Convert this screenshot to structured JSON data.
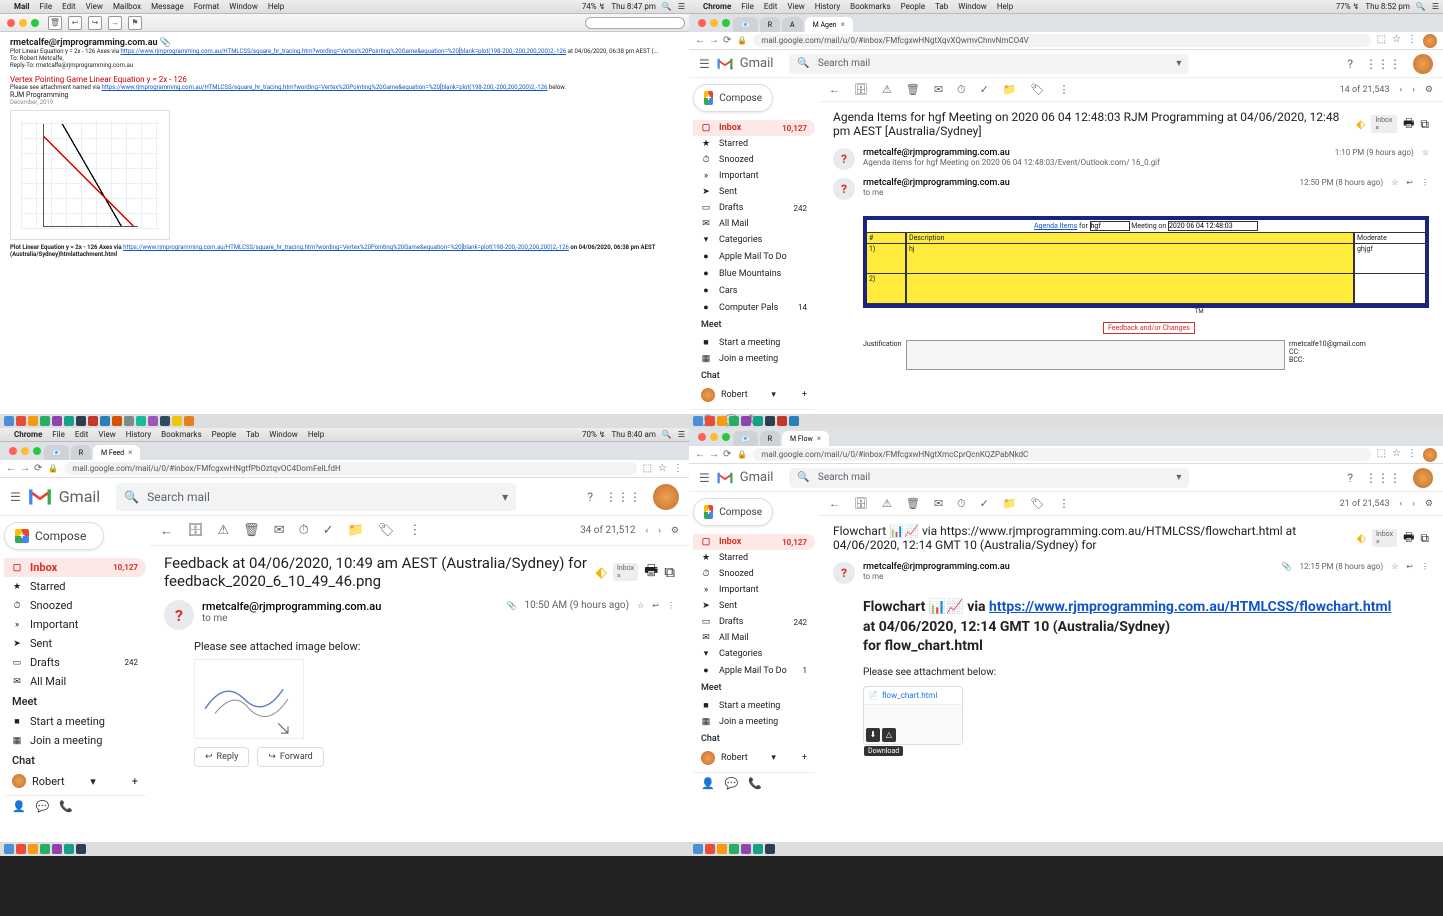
{
  "menubar_q1": {
    "app": "Mail",
    "menus": [
      "File",
      "Edit",
      "View",
      "Mailbox",
      "Message",
      "Format",
      "Window",
      "Help"
    ],
    "right": [
      "✈",
      "M",
      "⎆",
      "⚼",
      "⇪",
      "74% ↯",
      "Thu 8:47 pm",
      "🔍",
      "☰"
    ]
  },
  "menubar_q2": {
    "app": "Chrome",
    "menus": [
      "File",
      "Edit",
      "View",
      "History",
      "Bookmarks",
      "People",
      "Tab",
      "Window",
      "Help"
    ],
    "right": [
      "✈",
      "M",
      "⎆",
      "⚼",
      "⇪",
      "77% ↯",
      "Thu 8:52 pm",
      "🔍",
      "☰"
    ]
  },
  "menubar_q3": {
    "app": "Chrome",
    "menus": [
      "File",
      "Edit",
      "View",
      "History",
      "Bookmarks",
      "People",
      "Tab",
      "Window",
      "Help"
    ],
    "right": [
      "✈",
      "M",
      "⎆",
      "⚼",
      "⇪",
      "70% ↯",
      "Thu 8:40 am",
      "🔍",
      "☰"
    ]
  },
  "q1": {
    "from": "rmetcalfe@rjmprogramming.com.au",
    "line1_a": "Plot Linear Equation y = 2x - 126 Axes via ",
    "line1_url": "https://www.rjmprogramming.com.au/HTMLCSS/square_hr_tracing.htm?wording=Vertex%20Pointing%20Game&equation=%20[blank=plot(198-200,-200,200,200)2,-126",
    "line1_b": " at 04/06/2020, 06:38 pm AEST (...",
    "to": "To: Robert Metcalfe,",
    "replyto": "Reply-To: rmetcalfe@rjmprogramming.com.au",
    "heading": "Vertex Pointing Game Linear Equation y = 2x - 126",
    "subline_a": "Please see attachment named via ",
    "subline_url": "https://www.rjmprogramming.com.au/HTMLCSS/square_hr_tracing.htm?wording=Vertex%20Pointing%20Game&equation=%20[blank=plot(198-200,-200,200,200)2,-126",
    "subline_b": " below.",
    "sig1": "RJM Programming",
    "sig2": "December, 2019",
    "foot_a": "Plot Linear Equation y = 2x - 126 Axes via ",
    "foot_url": "https://www.rjmprogramming.com.au/HTMLCSS/square_hr_tracing.htm?wording=Vertex%20Pointing%20Game&equation=%20[blank=plot(198-200,-200,200,200)2,-126",
    "foot_b": " on 04/06/2020, 06:38 pm AEST (Australia/Sydney)htmlattachment.html"
  },
  "q2": {
    "url": "mail.google.com/mail/u/0/#inbox/FMfcgxwHNgtXqvXQwmvChnvNmCO4V",
    "search_placeholder": "Search mail",
    "counter": "14 of 21,543",
    "compose": "Compose",
    "sidebar": [
      {
        "ic": "▢",
        "label": "Inbox",
        "count": "10,127",
        "active": true
      },
      {
        "ic": "★",
        "label": "Starred"
      },
      {
        "ic": "⏱",
        "label": "Snoozed"
      },
      {
        "ic": "»",
        "label": "Important"
      },
      {
        "ic": "➤",
        "label": "Sent"
      },
      {
        "ic": "▭",
        "label": "Drafts",
        "count": "242"
      },
      {
        "ic": "✉",
        "label": "All Mail"
      },
      {
        "ic": "▾",
        "label": "Categories"
      },
      {
        "ic": "●",
        "label": "Apple Mail To Do"
      },
      {
        "ic": "●",
        "label": "Blue Mountains"
      },
      {
        "ic": "●",
        "label": "Cars"
      },
      {
        "ic": "●",
        "label": "Computer Pals",
        "count": "14"
      }
    ],
    "meet": "Meet",
    "meet_items": [
      "Start a meeting",
      "Join a meeting"
    ],
    "chat": "Chat",
    "chat_user": "Robert",
    "subject": "Agenda Items for hgf Meeting on 2020  06  04 12:48:03    RJM Programming at 04/06/2020, 12:48 pm AEST [Australia/Sydney]",
    "inbox_label": "Inbox ×",
    "sender": "rmetcalfe@rjmprogramming.com.au",
    "attach_name": "Agenda items for hgf Meeting on 2020 06 04 12:48:03/Event/Outlook.com/ 16_0.gif",
    "time1": "1:10 PM (9 hours ago)",
    "time2": "12:50 PM (8 hours ago)",
    "tome": "to me",
    "agenda_title_a": "Agenda Items",
    "agenda_title_b": " for ",
    "agenda_input": "hgf",
    "agenda_title_c": " Meeting on ",
    "agenda_date": "2020 06 04 12:48:03",
    "agenda_hdr": [
      "#",
      "Description",
      "Moderate"
    ],
    "agenda_rows": [
      {
        "n": "1)",
        "d": "hj",
        "m": "ghjgf"
      },
      {
        "n": "2)",
        "d": "",
        "m": ""
      }
    ],
    "feedback_btn": "Feedback and/or Changes",
    "tm": "TM",
    "justif_label": "Justification",
    "recipient": "rmetcalfe10@gmail.com",
    "cc": "CC:",
    "bcc": "BCC:"
  },
  "q3": {
    "url": "mail.google.com/mail/u/0/#inbox/FMfcgxwHNgtfPbOztqvOC4DomFelLfdH",
    "search_placeholder": "Search mail",
    "counter": "34 of 21,512",
    "compose": "Compose",
    "sidebar": [
      {
        "ic": "▢",
        "label": "Inbox",
        "count": "10,127",
        "active": true
      },
      {
        "ic": "★",
        "label": "Starred"
      },
      {
        "ic": "⏱",
        "label": "Snoozed"
      },
      {
        "ic": "»",
        "label": "Important"
      },
      {
        "ic": "➤",
        "label": "Sent"
      },
      {
        "ic": "▭",
        "label": "Drafts",
        "count": "242"
      },
      {
        "ic": "✉",
        "label": "All Mail"
      }
    ],
    "meet": "Meet",
    "meet_items": [
      "Start a meeting",
      "Join a meeting"
    ],
    "chat": "Chat",
    "chat_user": "Robert",
    "subject": "Feedback at 04/06/2020, 10:49 am AEST (Australia/Sydney) for feedback_2020_6_10_49_46.png",
    "inbox_label": "Inbox ×",
    "sender": "rmetcalfe@rjmprogramming.com.au",
    "tome": "to me",
    "time": "10:50 AM (9 hours ago)",
    "body": "Please see attached image below:",
    "reply": "Reply",
    "forward": "Forward"
  },
  "q4": {
    "url": "mail.google.com/mail/u/0/#inbox/FMfcgxwHNgtXmcCprQcnKQZPabNkdC",
    "search_placeholder": "Search mail",
    "counter": "21 of 21,543",
    "compose": "Compose",
    "sidebar": [
      {
        "ic": "▢",
        "label": "Inbox",
        "count": "10,127",
        "active": true
      },
      {
        "ic": "★",
        "label": "Starred"
      },
      {
        "ic": "⏱",
        "label": "Snoozed"
      },
      {
        "ic": "»",
        "label": "Important"
      },
      {
        "ic": "➤",
        "label": "Sent"
      },
      {
        "ic": "▭",
        "label": "Drafts",
        "count": "242"
      },
      {
        "ic": "✉",
        "label": "All Mail"
      },
      {
        "ic": "▾",
        "label": "Categories"
      },
      {
        "ic": "●",
        "label": "Apple Mail To Do",
        "count": "1"
      }
    ],
    "meet": "Meet",
    "meet_items": [
      "Start a meeting",
      "Join a meeting"
    ],
    "chat": "Chat",
    "chat_user": "Robert",
    "subject": "Flowchart 📊📈 via https://www.rjmprogramming.com.au/HTMLCSS/flowchart.html at 04/06/2020, 12:14 GMT 10 (Australia/Sydney) for",
    "inbox_label": "Inbox ×",
    "sender": "rmetcalfe@rjmprogramming.com.au",
    "tome": "to me",
    "time": "12:15 PM (8 hours ago)",
    "big_a": "Flowchart 📊📈 via ",
    "big_url": "https://www.rjmprogramming.com.au/HTMLCSS/flowchart.html",
    "big_b": "at 04/06/2020, 12:14 GMT 10 (Australia/Sydney)",
    "big_c": "for flow_chart.html",
    "body": "Please see attachment below:",
    "attach_name": "flow_chart.html",
    "download": "Download"
  },
  "gmail_brand": "Gmail"
}
